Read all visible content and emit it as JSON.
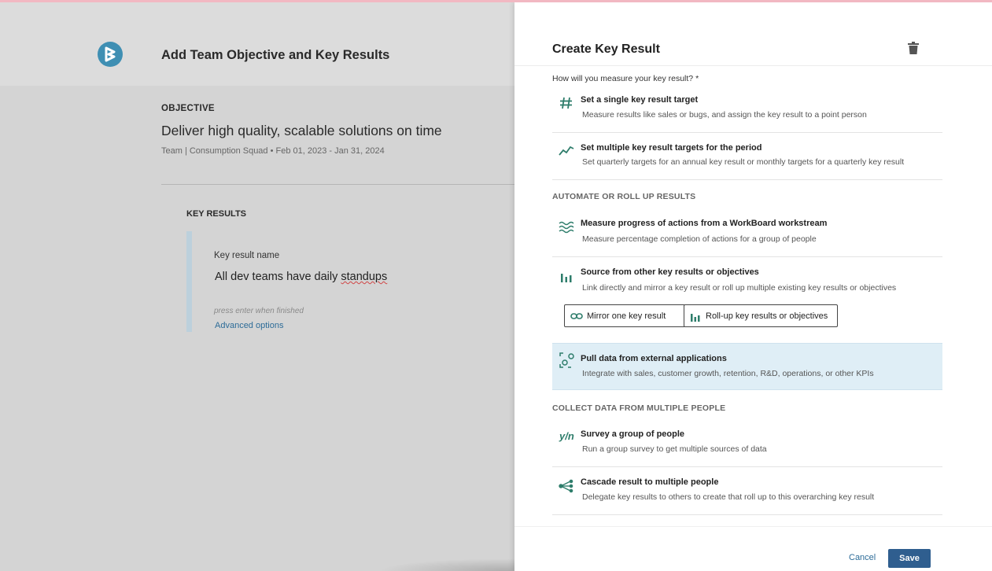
{
  "background": {
    "page_title": "Add Team Objective and Key Results",
    "objective": {
      "label": "OBJECTIVE",
      "title": "Deliver high quality, scalable solutions on time",
      "meta": "Team | Consumption Squad • Feb 01, 2023 - Jan 31, 2024"
    },
    "key_results": {
      "label": "KEY RESULTS",
      "name_label": "Key result name",
      "name_value_prefix": "All dev teams have daily ",
      "name_value_misspelled": "standups",
      "hint": "press enter when finished",
      "advanced": "Advanced options"
    }
  },
  "panel": {
    "title": "Create Key Result",
    "question": "How will you measure your key result? *",
    "options_top": [
      {
        "title": "Set a single key result target",
        "desc": "Measure results like sales or bugs, and assign the key result to a point person",
        "icon": "hash-icon"
      },
      {
        "title": "Set multiple key result targets for the period",
        "desc": "Set quarterly targets for an annual key result or monthly targets for a quarterly key result",
        "icon": "trend-line-icon"
      }
    ],
    "section_automate": "AUTOMATE OR ROLL UP RESULTS",
    "options_automate": [
      {
        "title": "Measure progress of actions from a WorkBoard workstream",
        "desc": "Measure percentage completion of actions for a group of people",
        "icon": "waves-icon"
      },
      {
        "title": "Source from other key results or objectives",
        "desc": "Link directly and mirror a key result or roll up multiple existing key results or objectives",
        "icon": "bar-chart-icon"
      }
    ],
    "mirror_button": "Mirror one key result",
    "rollup_button": "Roll-up key results or objectives",
    "option_pull": {
      "title": "Pull data from external applications",
      "desc": "Integrate with sales, customer growth, retention, R&D, operations, or other KPIs",
      "icon": "integration-icon"
    },
    "section_collect": "COLLECT DATA FROM MULTIPLE PEOPLE",
    "options_collect": [
      {
        "title": "Survey a group of people",
        "desc": "Run a group survey to get multiple sources of data",
        "icon": "yn-survey-icon",
        "icon_text": "y/n"
      },
      {
        "title": "Cascade result to multiple people",
        "desc": "Delegate key results to others to create that roll up to this overarching key result",
        "icon": "cascade-icon"
      }
    ],
    "cancel": "Cancel",
    "save": "Save"
  },
  "colors": {
    "accent": "#2f5e8f",
    "icon_green": "#2e7d6b",
    "highlight": "#dfeef6",
    "logo": "#3f8fb3"
  }
}
